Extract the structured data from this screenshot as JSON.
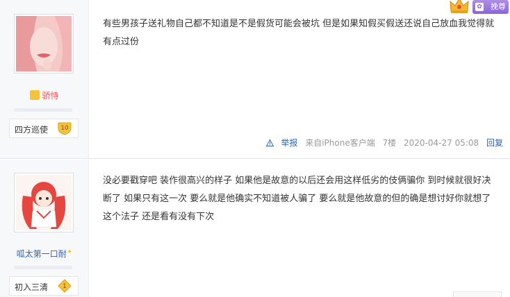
{
  "header": {
    "vip_label": "挽尊",
    "vip_icon": "paw-icon",
    "crown_icon": "crown-icon"
  },
  "posts": [
    {
      "username": "骄恃",
      "username_color": "#f74d4d",
      "level_name": "四方巡使",
      "level_number": "10",
      "content": "有些男孩子送礼物自己都不知道是不是假货可能会被坑 但是如果知假买假送还说自己放血我觉得就有点过份",
      "meta": {
        "report": "举报",
        "source": "来自iPhone客户端",
        "floor": "7楼",
        "time": "2020-04-27 05:08",
        "reply": "回复"
      }
    },
    {
      "username": "呱太第一口耐",
      "username_color": "#2d64b3",
      "level_name": "初入三清",
      "level_number": "1",
      "content": "没必要戳穿吧 装作很高兴的样子 如果他是故意的以后还会用这样低劣的伎俩骗你 到时候就很好决断了 如果只有这一次 要么就是他确实不知道被人骗了 要么就是他故意的但的确是想讨好你就想了这个法子 还是看有没有下次"
    }
  ],
  "colors": {
    "link": "#2d64b3",
    "meta_gray": "#999999",
    "badge_gold": "#f5c33b",
    "vip_purple": "#8c63d8"
  }
}
